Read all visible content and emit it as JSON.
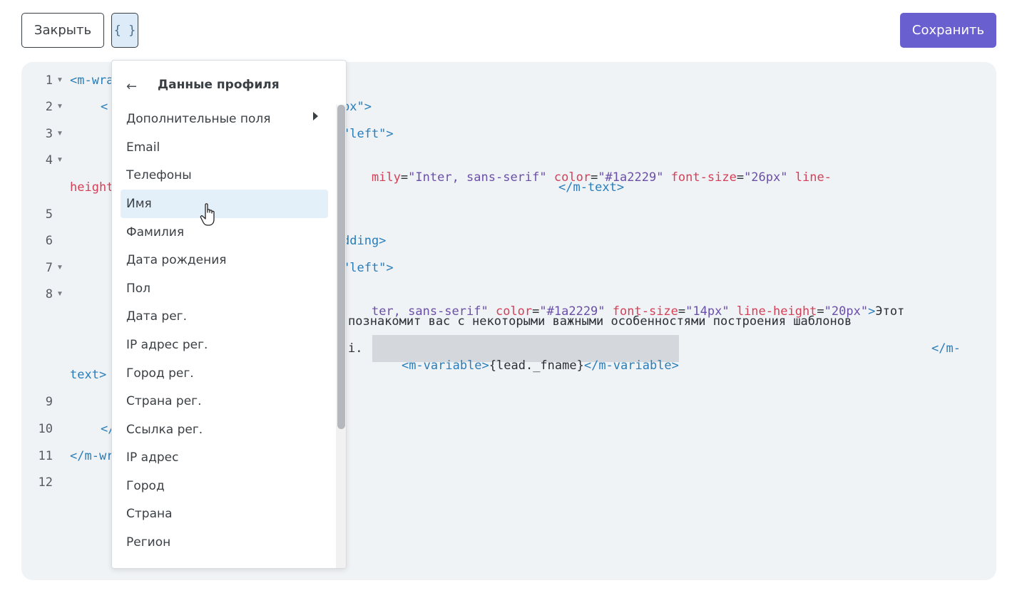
{
  "toolbar": {
    "close_label": "Закрыть",
    "vars_label": "{ }",
    "save_label": "Сохранить"
  },
  "colors": {
    "accent": "#6a5fcf",
    "editor_bg": "#f0f3f6",
    "tag": "#2a7db8",
    "attr": "#d43f57",
    "value": "#6a4fa8",
    "menu_active": "#e4f0f9"
  },
  "editor": {
    "line_numbers": [
      "1",
      "2",
      "3",
      "4",
      "5",
      "6",
      "7",
      "8",
      "9",
      "10",
      "11",
      "12"
    ],
    "fragments": {
      "l1": "<m-wra",
      "l2a": "<",
      "l2b": "px\">",
      "l3": "\"left\">",
      "l4a": "mily",
      "l4b": "=",
      "l4c": "\"Inter, sans-serif\"",
      "l4d": "color",
      "l4e": "=",
      "l4f": "\"#1a2229\"",
      "l4g": "font-size",
      "l4h": "=",
      "l4i": "\"26px\"",
      "l4j": "line-",
      "l4k": "height",
      "l4l": "</m-text>",
      "l6": "dding>",
      "l7": "\"left\">",
      "l8a": "ter, sans-serif\"",
      "l8b": "color",
      "l8c": "=",
      "l8d": "\"#1a2229\"",
      "l8e": "font-size",
      "l8f": "=",
      "l8g": "\"14px\"",
      "l8h": "line-height",
      "l8i": "=",
      "l8j": "\"20px\"",
      "l8k": ">",
      "l8l": "Этот",
      "l8m": "познакомит вас с некоторыми важными особенностями построения шаблонов",
      "l8n": "i.",
      "l8o": "<m-variable>",
      "l8p": "{lead._fname}",
      "l8q": "</m-variable>",
      "l8r": "</m-",
      "l8s": "text>",
      "l10": "</",
      "l11": "</m-wr"
    }
  },
  "dropdown": {
    "back_icon": "arrow-left-icon",
    "title": "Данные профиля",
    "items": [
      "Дополнительные поля",
      "Email",
      "Телефоны",
      "Имя",
      "Фамилия",
      "Дата рождения",
      "Пол",
      "Дата рег.",
      "IP адрес рег.",
      "Город рег.",
      "Страна рег.",
      "Ссылка рег.",
      "IP адрес",
      "Город",
      "Страна",
      "Регион"
    ],
    "active_item": "Имя"
  }
}
